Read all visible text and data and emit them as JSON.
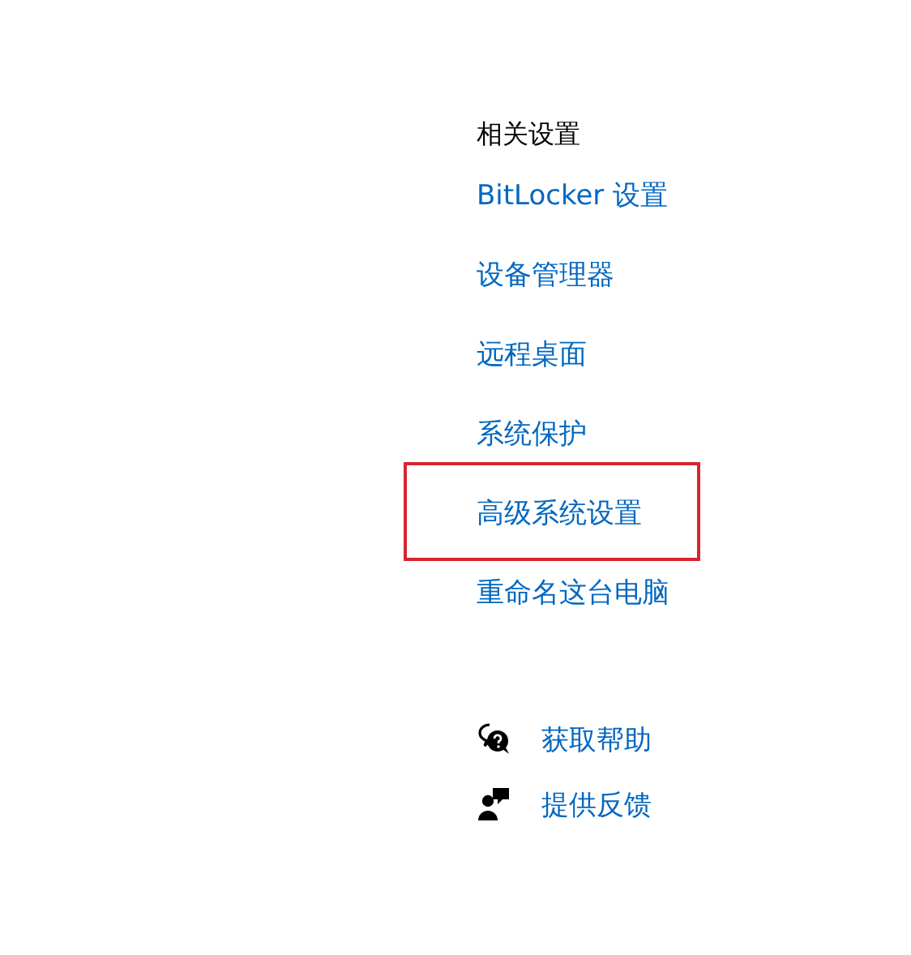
{
  "related_settings": {
    "title": "相关设置",
    "links": [
      {
        "label": "BitLocker 设置",
        "highlighted": false
      },
      {
        "label": "设备管理器",
        "highlighted": false
      },
      {
        "label": "远程桌面",
        "highlighted": false
      },
      {
        "label": "系统保护",
        "highlighted": false
      },
      {
        "label": "高级系统设置",
        "highlighted": true
      },
      {
        "label": "重命名这台电脑",
        "highlighted": false
      }
    ]
  },
  "help": [
    {
      "kind": "help",
      "label": "获取帮助"
    },
    {
      "kind": "feedback",
      "label": "提供反馈"
    }
  ]
}
